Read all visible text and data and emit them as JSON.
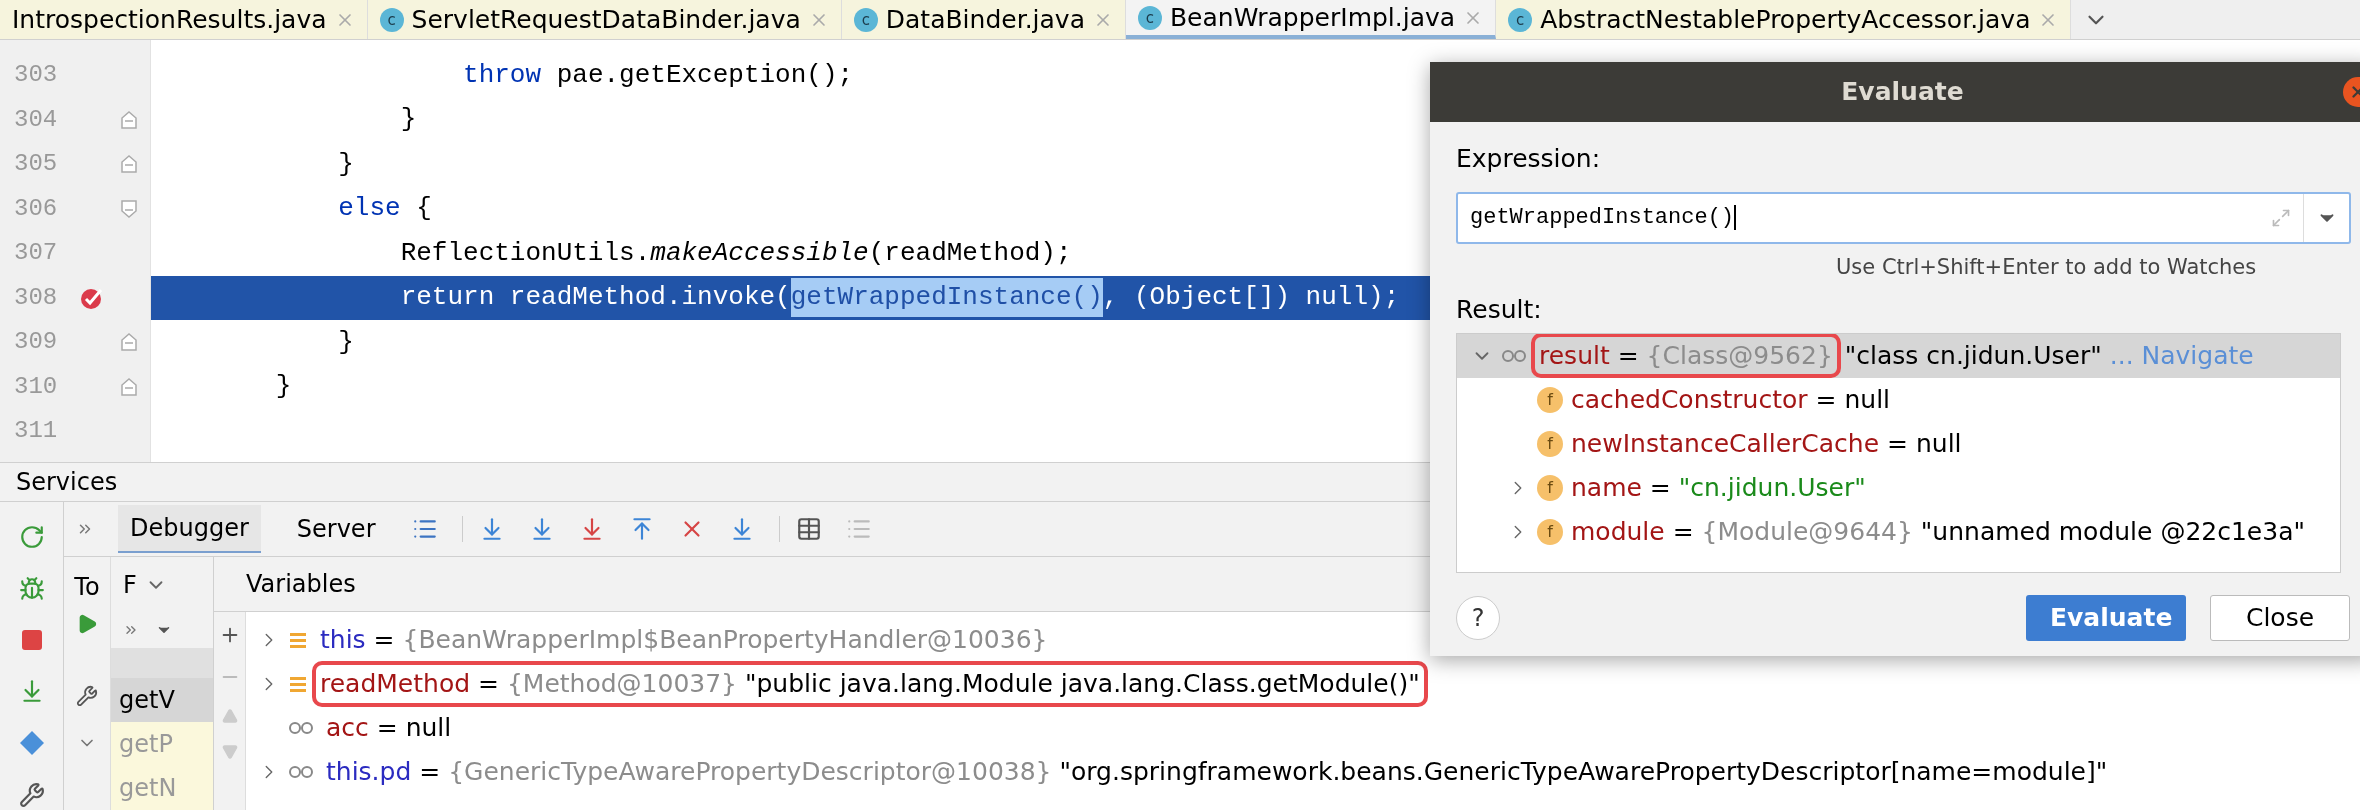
{
  "editor_tabs": [
    {
      "label": "IntrospectionResults.java",
      "selected": false
    },
    {
      "label": "ServletRequestDataBinder.java",
      "selected": false,
      "icon_letter": "c"
    },
    {
      "label": "DataBinder.java",
      "selected": false,
      "icon_letter": "c"
    },
    {
      "label": "BeanWrapperImpl.java",
      "selected": true,
      "icon_letter": "c"
    },
    {
      "label": "AbstractNestablePropertyAccessor.java",
      "selected": false,
      "icon_letter": "c"
    }
  ],
  "code_lines": [
    {
      "number": "303",
      "breakpoint": false,
      "current": false,
      "fold_start": false,
      "fold_end": false,
      "tokens": [
        {
          "text": "                    throw",
          "kind": "keyword"
        },
        {
          "text": " pae.getException();",
          "kind": "plain"
        }
      ]
    },
    {
      "number": "304",
      "breakpoint": false,
      "current": false,
      "fold_start": false,
      "fold_end": true,
      "tokens": [
        {
          "text": "                }",
          "kind": "plain"
        }
      ]
    },
    {
      "number": "305",
      "breakpoint": false,
      "current": false,
      "fold_start": false,
      "fold_end": true,
      "tokens": [
        {
          "text": "            }",
          "kind": "plain"
        }
      ]
    },
    {
      "number": "306",
      "breakpoint": false,
      "current": false,
      "fold_start": true,
      "fold_end": false,
      "tokens": [
        {
          "text": "            else",
          "kind": "keyword"
        },
        {
          "text": " {",
          "kind": "plain"
        }
      ]
    },
    {
      "number": "307",
      "breakpoint": false,
      "current": false,
      "fold_start": false,
      "fold_end": false,
      "tokens": [
        {
          "text": "                ReflectionUtils.",
          "kind": "plain"
        },
        {
          "text": "makeAccessible",
          "kind": "italic"
        },
        {
          "text": "(readMethod);",
          "kind": "plain"
        }
      ]
    },
    {
      "number": "308",
      "breakpoint": true,
      "current": true,
      "fold_start": false,
      "fold_end": false,
      "tokens": [
        {
          "text": "                return",
          "kind": "keyword"
        },
        {
          "text": " readMethod.invoke(",
          "kind": "plain"
        },
        {
          "text": "getWrappedInstance()",
          "kind": "selection"
        },
        {
          "text": ", (Object[]) null);",
          "kind": "plain"
        }
      ]
    },
    {
      "number": "309",
      "breakpoint": false,
      "current": false,
      "fold_start": false,
      "fold_end": true,
      "tokens": [
        {
          "text": "            }",
          "kind": "plain"
        }
      ]
    },
    {
      "number": "310",
      "breakpoint": false,
      "current": false,
      "fold_start": false,
      "fold_end": true,
      "tokens": [
        {
          "text": "        }",
          "kind": "plain"
        }
      ]
    },
    {
      "number": "311",
      "breakpoint": false,
      "current": false,
      "fold_start": false,
      "fold_end": false
    }
  ],
  "services": {
    "title": "Services",
    "debugger_tabs": [
      {
        "label": "Debugger",
        "selected": true
      },
      {
        "label": "Server",
        "selected": false
      }
    ],
    "frames_header": "F",
    "threads_label": "To",
    "frames": [
      {
        "label": "getV",
        "selected": true
      },
      {
        "label": "getP",
        "selected": false
      },
      {
        "label": "getN",
        "selected": false
      }
    ],
    "variables_header": "Variables",
    "variables": [
      {
        "name": "this",
        "object_ref": true,
        "kind": "field",
        "expandable": true,
        "operator": "=",
        "type_ref": "{BeanWrapperImpl$BeanPropertyHandler@10036}",
        "highlighted": false
      },
      {
        "name": "readMethod",
        "object_ref": false,
        "kind": "field",
        "expandable": true,
        "operator": "=",
        "type_ref": "{Method@10037}",
        "value": "\"public java.lang.Module java.lang.Class.getModule()\"",
        "highlighted": true
      },
      {
        "name": "acc",
        "object_ref": false,
        "kind": "watch",
        "expandable": false,
        "operator": "=",
        "value": "null",
        "highlighted": false
      },
      {
        "name": "this.pd",
        "object_ref": true,
        "kind": "watch",
        "expandable": true,
        "operator": "=",
        "type_ref": "{GenericTypeAwarePropertyDescriptor@10038}",
        "value": "\"org.springframework.beans.GenericTypeAwarePropertyDescriptor[name=module]\"",
        "highlighted": false
      }
    ]
  },
  "dialog": {
    "title": "Evaluate",
    "expression_label": "Expression:",
    "expression": "getWrappedInstance()",
    "hint": "Use Ctrl+Shift+Enter to add to Watches",
    "result_label": "Result:",
    "result": {
      "name": "result",
      "operator": "=",
      "type_ref": "{Class@9562}",
      "value": "\"class cn.jidun.User\"",
      "link": "... Navigate",
      "expanded": true,
      "highlighted": true,
      "children": [
        {
          "icon_letter": "f",
          "name": "cachedConstructor",
          "operator": "=",
          "value": "null",
          "string": false,
          "expandable": false
        },
        {
          "icon_letter": "f",
          "name": "newInstanceCallerCache",
          "operator": "=",
          "value": "null",
          "string": false,
          "expandable": false
        },
        {
          "icon_letter": "f",
          "name": "name",
          "operator": "=",
          "value": "\"cn.jidun.User\"",
          "string": true,
          "expandable": true
        },
        {
          "icon_letter": "f",
          "name": "module",
          "operator": "=",
          "type_ref": "{Module@9644}",
          "value": "\"unnamed module @22c1e3a\"",
          "string": false,
          "expandable": true
        }
      ]
    },
    "help": "?",
    "buttons": [
      {
        "label": "Evaluate",
        "kind": "primary"
      },
      {
        "label": "Close",
        "kind": "secondary"
      }
    ]
  }
}
